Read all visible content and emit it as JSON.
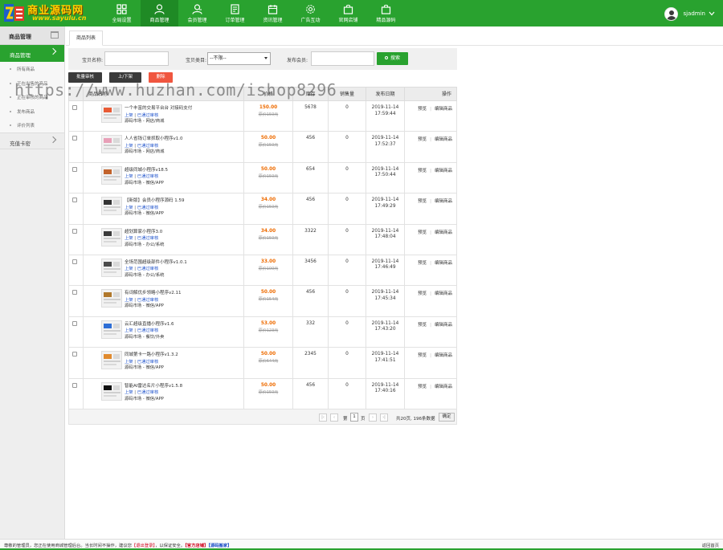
{
  "logo": {
    "brand": "商业源码网",
    "url": "www.sayulu.cn"
  },
  "nav": [
    {
      "label": "全局设置",
      "icon": "grid-icon",
      "active": false
    },
    {
      "label": "商品管理",
      "icon": "user-icon",
      "active": true
    },
    {
      "label": "会员管理",
      "icon": "member-icon",
      "active": false
    },
    {
      "label": "订单管理",
      "icon": "doc-icon",
      "active": false
    },
    {
      "label": "资讯管理",
      "icon": "calendar-icon",
      "active": false
    },
    {
      "label": "广告互动",
      "icon": "gear-icon",
      "active": false
    },
    {
      "label": "官网店铺",
      "icon": "bag-icon",
      "active": false
    },
    {
      "label": "精品源码",
      "icon": "bag-icon",
      "active": false
    }
  ],
  "user": {
    "name": "sjadmin"
  },
  "sidebar": {
    "title": "商品管理",
    "group1": "商品管理",
    "items": [
      "所有商品",
      "正在出售的商品",
      "正在审核的商品",
      "发布商品",
      "评价列表"
    ],
    "group2": "充值卡密"
  },
  "tabs": {
    "active": "商品列表"
  },
  "filter": {
    "name_label": "宝贝名称:",
    "category_label": "宝贝类目:",
    "category_value": "--不限--",
    "member_label": "发布会员:",
    "search_label": "搜索"
  },
  "actions": {
    "batch_review": "批量审核",
    "shelf": "上/下架",
    "delete": "删除"
  },
  "colors": {
    "green": "#29a22f",
    "dark": "#3b3b3b",
    "red": "#f0563f",
    "orange": "#ee6b00"
  },
  "table": {
    "headers": [
      "商品名称",
      "价格",
      "库存",
      "销售量",
      "发布日期",
      "操作"
    ],
    "status_published": "上架",
    "status_reviewed": "已通过审核",
    "op_preview": "预览",
    "op_edit": "编辑商品",
    "rows": [
      {
        "name": "一个丰富的交易平台台 对接码支付",
        "price": "150.00",
        "original": "原价150元",
        "stock": "5678",
        "sales": "0",
        "date": "2019-11-14",
        "time": "17:59:44",
        "category": "源码市场 - 网店/商城",
        "thumb": "#e95b35"
      },
      {
        "name": "人人省钱订单抓取小程序v1.0",
        "price": "50.00",
        "original": "原价150元",
        "stock": "456",
        "sales": "0",
        "date": "2019-11-14",
        "time": "17:52:37",
        "category": "源码市场 - 网店/商城",
        "thumb": "#e8a0b8"
      },
      {
        "name": "超级同城小程序v18.5",
        "price": "50.00",
        "original": "原价150元",
        "stock": "654",
        "sales": "0",
        "date": "2019-11-14",
        "time": "17:50:44",
        "category": "源码市场 - 微信/APP",
        "thumb": "#c2632c"
      },
      {
        "name": "【新版】会员小程序源码 1.59",
        "price": "34.00",
        "original": "原价150元",
        "stock": "456",
        "sales": "0",
        "date": "2019-11-14",
        "time": "17:49:29",
        "category": "源码市场 - 微信/APP",
        "thumb": "#333333"
      },
      {
        "name": "超划算家小程序3.0",
        "price": "34.00",
        "original": "原价150元",
        "stock": "3322",
        "sales": "0",
        "date": "2019-11-14",
        "time": "17:48:04",
        "category": "源码市场 - 办公/系统",
        "thumb": "#3a3a3a"
      },
      {
        "name": "全场范围超级部件小程序v1.0.1",
        "price": "33.00",
        "original": "原价100元",
        "stock": "3456",
        "sales": "0",
        "date": "2019-11-14",
        "time": "17:46:49",
        "category": "源码市场 - 办公/系统",
        "thumb": "#4b4b4b"
      },
      {
        "name": "有词解优步领略小程序v2.11",
        "price": "50.00",
        "original": "原价154元",
        "stock": "456",
        "sales": "0",
        "date": "2019-11-14",
        "time": "17:45:34",
        "category": "源码市场 - 微信/APP",
        "thumb": "#b0782c"
      },
      {
        "name": "云汇超级直播小程序v1.6",
        "price": "53.00",
        "original": "原价123元",
        "stock": "332",
        "sales": "0",
        "date": "2019-11-14",
        "time": "17:43:20",
        "category": "源码市场 - 餐饮/外卖",
        "thumb": "#2f6fd6"
      },
      {
        "name": "同城第卡一路小程序v1.3.2",
        "price": "50.00",
        "original": "原价644元",
        "stock": "2345",
        "sales": "0",
        "date": "2019-11-14",
        "time": "17:41:51",
        "category": "源码市场 - 微信/APP",
        "thumb": "#e08a2e"
      },
      {
        "name": "智能AI雷达名片小程序v1.5.8",
        "price": "50.00",
        "original": "原价150元",
        "stock": "456",
        "sales": "0",
        "date": "2019-11-14",
        "time": "17:40:16",
        "category": "源码市场 - 微信/APP",
        "thumb": "#111111"
      }
    ]
  },
  "pager": {
    "page_prefix": "第",
    "page": "1",
    "page_suffix": "页",
    "summary": "共20页, 196条数据",
    "go": "确定"
  },
  "watermark": "https://www.huzhan.com/ishop8296",
  "footer": {
    "notice_a": "尊敬的管理员，您正在使用商城管理后台。当长时间不操作，建议您",
    "logout": "【退出登录】",
    "notice_b": "，以保证安全。",
    "link1": "【官方店铺】",
    "link2": "【源码搬家】",
    "back": "返回首页"
  }
}
